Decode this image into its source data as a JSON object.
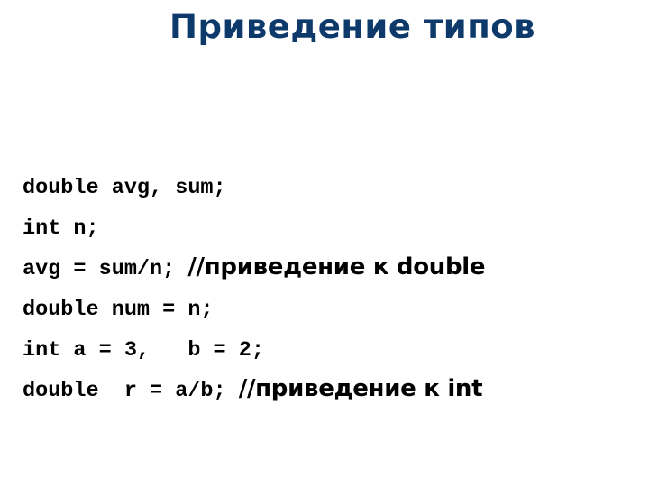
{
  "slide": {
    "title": "Приведение типов",
    "title_color": "#0e3a6b",
    "code_lines": [
      {
        "code": "double avg, sum;",
        "comment": ""
      },
      {
        "code": "int n;",
        "comment": ""
      },
      {
        "code": "avg = sum/n; ",
        "comment": "//приведение к double"
      },
      {
        "code": "double num = n;",
        "comment": ""
      },
      {
        "code": "int a = 3,   b = 2;",
        "comment": ""
      },
      {
        "code": "double  r = a/b; ",
        "comment": "//приведение к int"
      }
    ]
  }
}
